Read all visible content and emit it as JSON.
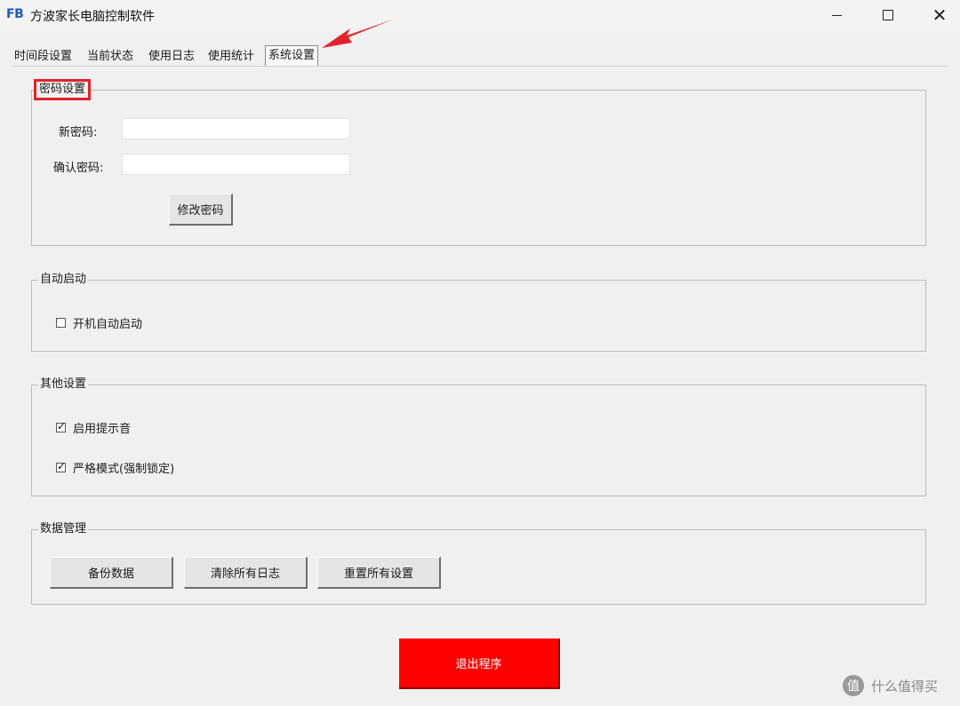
{
  "window": {
    "logo": "FB",
    "title": "方波家长电脑控制软件",
    "controls": {
      "minimize": "minimize",
      "maximize": "maximize",
      "close": "✕"
    }
  },
  "tabs": [
    {
      "label": "时间段设置",
      "active": false
    },
    {
      "label": "当前状态",
      "active": false
    },
    {
      "label": "使用日志",
      "active": false
    },
    {
      "label": "使用统计",
      "active": false
    },
    {
      "label": "系统设置",
      "active": true
    }
  ],
  "password_group": {
    "title": "密码设置",
    "new_password_label": "新密码:",
    "new_password_value": "",
    "confirm_password_label": "确认密码:",
    "confirm_password_value": "",
    "change_button": "修改密码"
  },
  "autostart_group": {
    "title": "自动启动",
    "checkbox_label": "开机自动启动",
    "checked": false
  },
  "other_group": {
    "title": "其他设置",
    "sound_label": "启用提示音",
    "sound_checked": true,
    "strict_label": "严格模式(强制锁定)",
    "strict_checked": true
  },
  "data_group": {
    "title": "数据管理",
    "backup_button": "备份数据",
    "clear_logs_button": "清除所有日志",
    "reset_button": "重置所有设置"
  },
  "exit_button": "退出程序",
  "colors": {
    "exit_button_bg": "#ff0000",
    "annotation_red": "#e3222c",
    "logo_blue": "#1d5fb8"
  },
  "watermark": {
    "icon": "值",
    "text": "什么值得买"
  }
}
